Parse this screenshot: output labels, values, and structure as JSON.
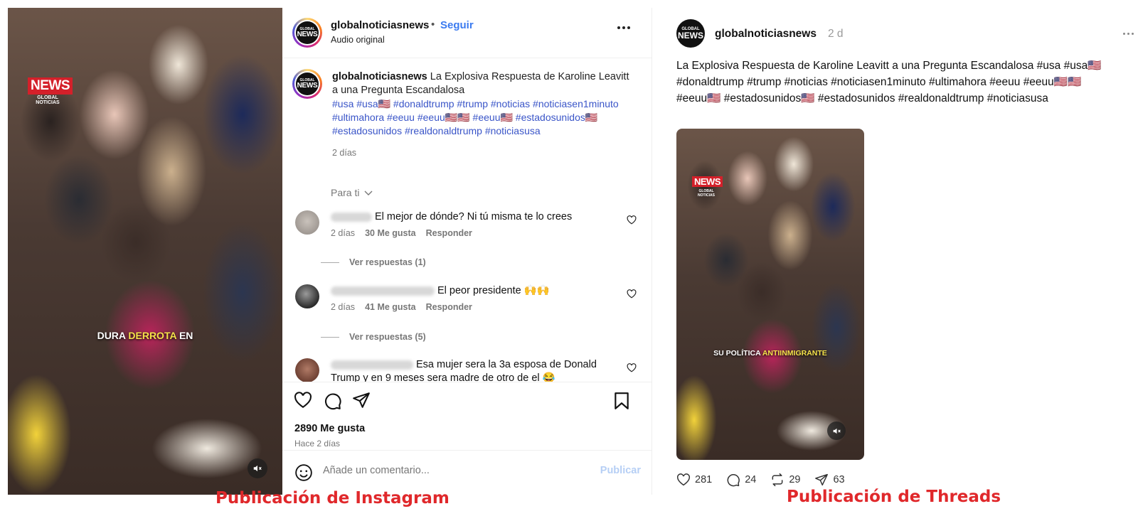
{
  "instagram": {
    "video": {
      "logo_big": "NEWS",
      "logo_small": "GLOBAL NOTICIAS",
      "caption_part1": "DURA ",
      "caption_highlight": "DERROTA",
      "caption_part2": " EN"
    },
    "header": {
      "username": "globalnoticiasnews",
      "separator": "•",
      "follow_label": "Seguir",
      "audio": "Audio original"
    },
    "avatar_text_top": "GLOBAL",
    "avatar_text_main": "NEWS",
    "post": {
      "username": "globalnoticiasnews",
      "text": "La Explosiva Respuesta de Karoline Leavitt a una Pregunta Escandalosa",
      "hashtags": "#usa #usa🇺🇸 #donaldtrump #trump #noticias #noticiasen1minuto #ultimahora #eeuu #eeuu🇺🇸🇺🇸 #eeuu🇺🇸 #estadosunidos🇺🇸 #estadosunidos #realdonaldtrump #noticiasusa",
      "time": "2 días"
    },
    "para_ti": "Para ti",
    "comments": [
      {
        "text": "El mejor de dónde? Ni tú misma te lo crees",
        "time": "2 días",
        "likes": "30 Me gusta",
        "reply": "Responder",
        "replies": "Ver respuestas (1)"
      },
      {
        "text": "El peor presidente 🙌🙌",
        "time": "2 días",
        "likes": "41 Me gusta",
        "reply": "Responder",
        "replies": "Ver respuestas (5)"
      },
      {
        "text": "Esa mujer sera la 3a esposa de Donald Trump y en 9 meses sera madre de otro de el 😂"
      }
    ],
    "likes": "2890 Me gusta",
    "ago": "Hace 2 días",
    "comment_placeholder": "Añade un comentario...",
    "publish_label": "Publicar",
    "label": "Publicación de Instagram"
  },
  "threads": {
    "username": "globalnoticiasnews",
    "time": "2 d",
    "text": "La Explosiva Respuesta de Karoline Leavitt a una Pregunta Escandalosa #usa #usa🇺🇸 #donaldtrump #trump #noticias #noticiasen1minuto #ultimahora #eeuu #eeuu🇺🇸🇺🇸 #eeuu🇺🇸 #estadosunidos🇺🇸 #estadosunidos #realdonaldtrump #noticiasusa",
    "video": {
      "logo_big": "NEWS",
      "logo_small": "GLOBAL NOTICIAS",
      "caption_part1": "SU POLÍTICA ",
      "caption_highlight": "ANTIINMIGRANTE"
    },
    "stats": {
      "likes": "281",
      "comments": "24",
      "reposts": "29",
      "shares": "63"
    },
    "label": "Publicación de Threads"
  },
  "colors": {
    "link_blue": "#3b7bf0",
    "hashtag_blue": "#3a55c8",
    "label_red": "#e0282b"
  }
}
